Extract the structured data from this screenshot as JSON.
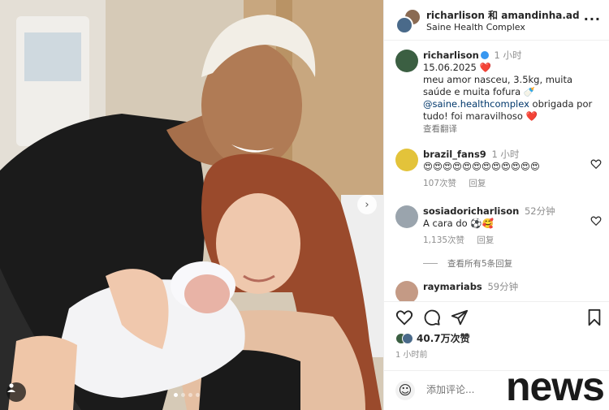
{
  "header": {
    "names": "richarlison 和 amandinha.ad",
    "location": "Saine Health Complex",
    "more_icon": "more-horizontal-icon"
  },
  "caption": {
    "username": "richarlison",
    "time": "1 小时",
    "line1": "15.06.2025 ❤️",
    "line2": "meu amor nasceu, 3.5kg, muita saúde e muita fofura 🍼",
    "mention": "@saine.healthcomplex",
    "line3": " obrigada por tudo! foi maravilhoso ❤️",
    "translate": "查看翻译"
  },
  "comments": [
    {
      "username": "brazil_fans9",
      "time": "1 小时",
      "text": "😍😍😍😍😍😍😍😍😍😍😍😍",
      "likes": "107次赞",
      "reply": "回复"
    },
    {
      "username": "sosiadoricharlison",
      "time": "52分钟",
      "text": "A cara do ⚽🥰",
      "likes": "1,135次赞",
      "reply": "回复"
    },
    {
      "username": "raymariabs",
      "time": "59分钟",
      "text": ""
    }
  ],
  "view_replies": "查看所有5条回复",
  "likes_total": "40.7万次赞",
  "posted_ago": "1 小时前",
  "add_comment_placeholder": "添加评论...",
  "watermark": "news",
  "colors": {
    "link": "#00376b",
    "verified": "#3897f0",
    "muted": "#8e8e8e",
    "heart_red": "#ed4956"
  }
}
